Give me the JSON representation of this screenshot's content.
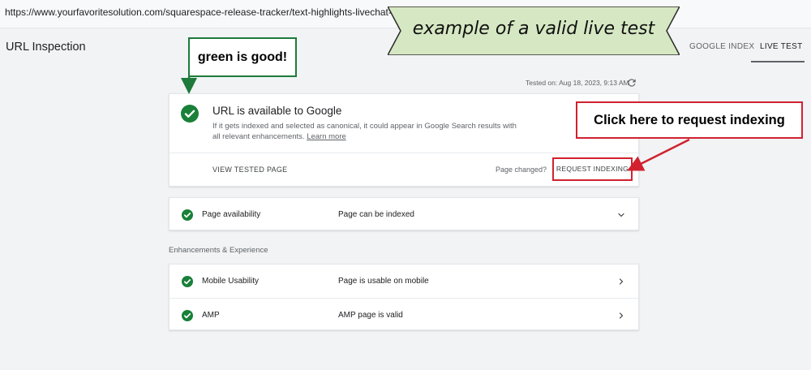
{
  "address_bar": {
    "url": "https://www.yourfavoritesolution.com/squarespace-release-tracker/text-highlights-livechat-order-status"
  },
  "header": {
    "title": "URL Inspection",
    "tabs": [
      {
        "label": "GOOGLE INDEX",
        "active": false
      },
      {
        "label": "LIVE TEST",
        "active": true
      }
    ]
  },
  "test": {
    "tested_on": "Tested on: Aug 18, 2023, 9:13 AM"
  },
  "status_card": {
    "title": "URL is available to Google",
    "description": "If it gets indexed and selected as canonical, it could appear in Google Search results with all relevant enhancements.",
    "learn_more": "Learn more",
    "view_tested_page": "VIEW TESTED PAGE",
    "page_changed": "Page changed?",
    "request_indexing": "REQUEST INDEXING"
  },
  "availability": {
    "label": "Page availability",
    "value": "Page can be indexed"
  },
  "enhancements": {
    "section_label": "Enhancements & Experience",
    "items": [
      {
        "label": "Mobile Usability",
        "value": "Page is usable on mobile"
      },
      {
        "label": "AMP",
        "value": "AMP page is valid"
      }
    ]
  },
  "annotations": {
    "banner": "example of a valid live test",
    "green_note": "green is good!",
    "red_note": "Click here to request indexing"
  },
  "colors": {
    "success_green": "#188038",
    "annotation_red": "#d1212f",
    "annotation_green": "#1d7a3a",
    "banner_fill": "#d6e8c3"
  },
  "icons": {
    "refresh": "refresh-icon",
    "check": "check-circle-icon",
    "expand": "chevron-down-icon",
    "open": "chevron-right-icon"
  }
}
